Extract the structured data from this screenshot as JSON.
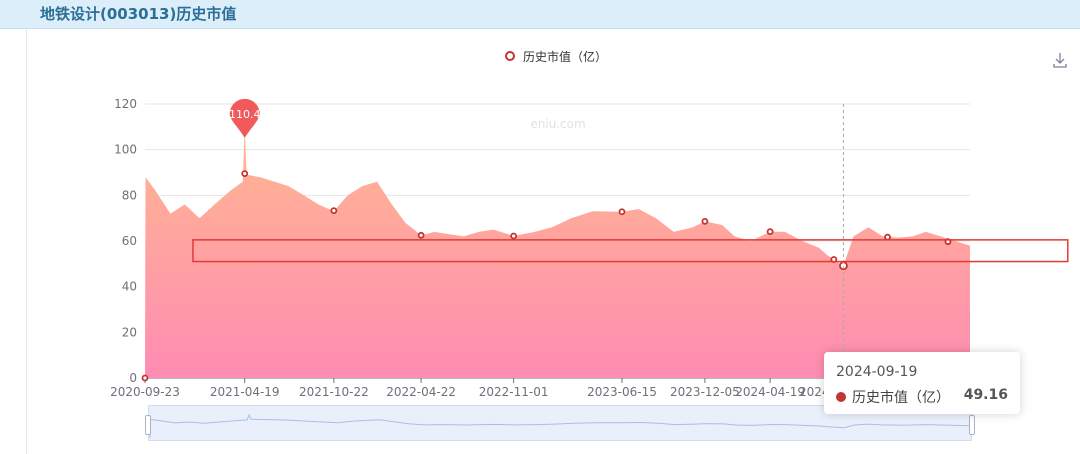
{
  "header": {
    "title": "地铁设计(003013)历史市值"
  },
  "colors": {
    "accent": "#c23531",
    "area_top": "#ffb78f",
    "area_bottom": "#ff8cb3",
    "highlight_box": "#e53935",
    "pin": "#f05a5a"
  },
  "icons": {
    "download": "download-icon"
  },
  "chart_data": {
    "type": "area",
    "title": "",
    "legend": [
      "历史市值（亿）"
    ],
    "legend_position": "top-center",
    "xlabel": "",
    "ylabel": "",
    "ylim": [
      0,
      120
    ],
    "yticks": [
      0,
      20,
      40,
      60,
      80,
      100,
      120
    ],
    "xticks": [
      "2020-09-23",
      "2021-04-19",
      "2021-10-22",
      "2022-04-22",
      "2022-11-01",
      "2023-06-15",
      "2023-12-05",
      "2024-04-19",
      "2024-08-30"
    ],
    "grid": true,
    "watermark": "eniu.com",
    "series": [
      {
        "name": "历史市值（亿）",
        "dates": [
          "2020-09-23",
          "2020-09-24",
          "2020-10-15",
          "2020-11-15",
          "2020-12-15",
          "2021-01-15",
          "2021-02-15",
          "2021-03-20",
          "2021-04-15",
          "2021-04-19",
          "2021-04-23",
          "2021-05-20",
          "2021-06-20",
          "2021-07-20",
          "2021-08-20",
          "2021-09-20",
          "2021-10-22",
          "2021-11-20",
          "2021-12-20",
          "2022-01-20",
          "2022-02-20",
          "2022-03-20",
          "2022-04-22",
          "2022-05-20",
          "2022-06-20",
          "2022-07-20",
          "2022-08-20",
          "2022-09-20",
          "2022-11-01",
          "2022-12-15",
          "2023-01-20",
          "2023-03-01",
          "2023-04-15",
          "2023-06-15",
          "2023-07-20",
          "2023-08-25",
          "2023-10-01",
          "2023-11-10",
          "2023-12-05",
          "2024-01-10",
          "2024-02-05",
          "2024-03-10",
          "2024-04-19",
          "2024-05-20",
          "2024-06-25",
          "2024-07-30",
          "2024-08-15",
          "2024-08-30",
          "2024-09-19",
          "2024-10-10",
          "2024-11-10",
          "2024-12-10",
          "2025-01-10",
          "2025-02-10",
          "2025-03-10",
          "2025-04-10",
          "2025-05-10",
          "2025-06-10"
        ],
        "values": [
          0,
          88,
          82,
          72,
          76,
          70,
          76,
          82,
          86,
          110.4,
          89,
          88,
          86,
          84,
          80,
          76,
          73,
          80,
          84,
          86,
          76,
          68,
          62.5,
          64,
          63,
          62,
          64,
          65,
          62.2,
          64,
          66,
          70,
          73,
          72.8,
          74,
          70,
          64,
          66,
          68.6,
          67,
          62,
          60,
          64.1,
          64,
          60,
          57,
          54,
          51.9,
          49.16,
          62,
          66,
          62,
          61.5,
          62,
          64,
          62,
          60,
          58
        ]
      }
    ],
    "marked_points": [
      {
        "date": "2020-09-23",
        "value": 0
      },
      {
        "date": "2021-04-19",
        "value": 89.5
      },
      {
        "date": "2021-10-22",
        "value": 73.3
      },
      {
        "date": "2022-04-22",
        "value": 62.5
      },
      {
        "date": "2022-11-01",
        "value": 62.2
      },
      {
        "date": "2023-06-15",
        "value": 72.8
      },
      {
        "date": "2023-12-05",
        "value": 68.6
      },
      {
        "date": "2024-04-19",
        "value": 64.1
      },
      {
        "date": "2024-08-30",
        "value": 51.9
      },
      {
        "date": "2024-09-19",
        "value": 49.16
      },
      {
        "date": "2024-12-20",
        "value": 61.7
      },
      {
        "date": "2025-04-25",
        "value": 59.7
      }
    ],
    "max_marker": {
      "label": "110.4",
      "date": "2021-04-19",
      "value": 110.4
    },
    "highlight_box": {
      "y_range": [
        51,
        60.5
      ],
      "date_range": [
        "2021-01-01",
        "2025-12-31"
      ]
    },
    "crosshair_date": "2024-09-19",
    "tooltip": {
      "date": "2024-09-19",
      "series": "历史市值（亿）",
      "value": "49.16"
    }
  }
}
